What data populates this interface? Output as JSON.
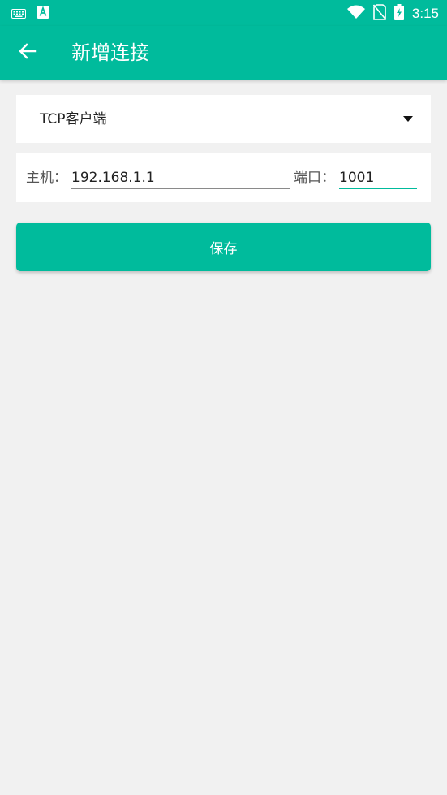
{
  "status_bar": {
    "time": "3:15",
    "icons": [
      "keyboard-icon",
      "a-notification-icon",
      "wifi-icon",
      "no-sim-icon",
      "battery-charging-icon"
    ]
  },
  "app_bar": {
    "title": "新增连接",
    "back_icon": "arrow-left-icon"
  },
  "connection_type": {
    "selected": "TCP客户端",
    "icon": "dropdown-arrow-icon"
  },
  "host": {
    "label": "主机：",
    "value": "192.168.1.1"
  },
  "port": {
    "label": "端口：",
    "value": "1001"
  },
  "save_button": {
    "label": "保存"
  },
  "colors": {
    "primary": "#00bb9c",
    "background": "#f1f1f1",
    "card": "#ffffff"
  }
}
